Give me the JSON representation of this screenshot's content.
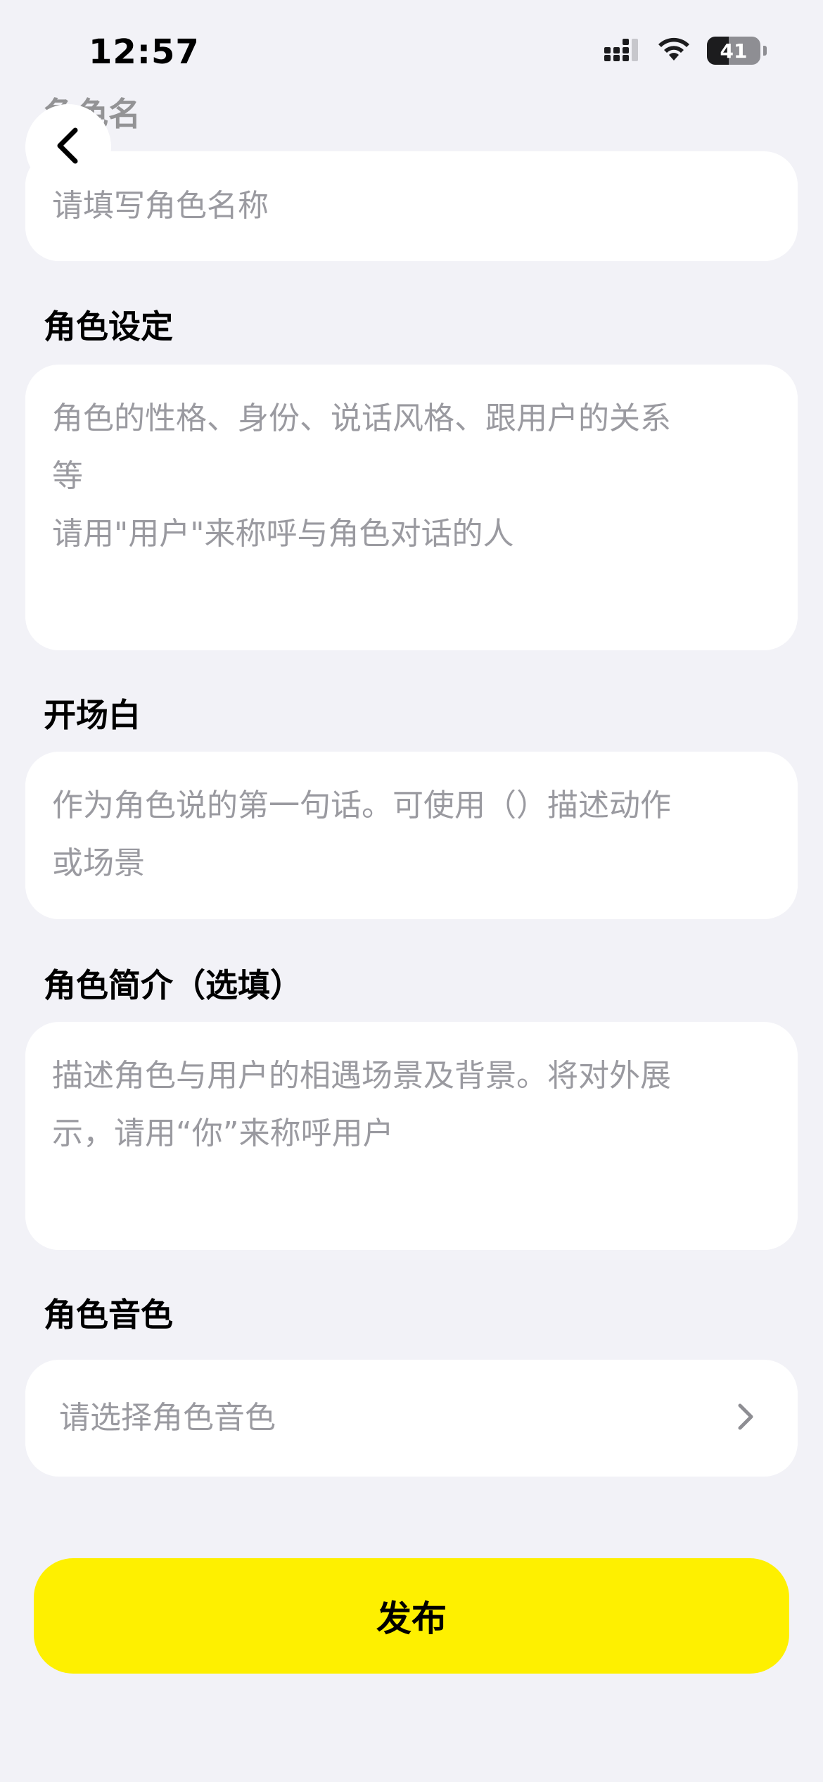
{
  "status_bar": {
    "time": "12:57",
    "battery_level": "41",
    "battery_fraction": 0.41,
    "icons": [
      "cellular-signal-icon",
      "wifi-icon",
      "battery-icon"
    ]
  },
  "nav": {
    "back_icon": "chevron-left-icon"
  },
  "form": {
    "name": {
      "label": "角色名",
      "placeholder": "请填写角色名称"
    },
    "setting": {
      "label": "角色设定",
      "placeholder_lines": [
        "角色的性格、身份、说话风格、跟用户的关系",
        "等",
        "请用\"用户\"来称呼与角色对话的人"
      ]
    },
    "opening": {
      "label": "开场白",
      "placeholder_lines": [
        "作为角色说的第一句话。可使用（）描述动作",
        "或场景"
      ]
    },
    "intro": {
      "label": "角色简介（选填）",
      "placeholder_lines": [
        "描述角色与用户的相遇场景及背景。将对外展",
        "示，请用“你”来称呼用户"
      ]
    },
    "voice": {
      "label": "角色音色",
      "placeholder": "请选择角色音色",
      "icon": "chevron-right-icon"
    }
  },
  "publish": {
    "label": "发布"
  },
  "colors": {
    "background": "#f2f2f7",
    "card": "#ffffff",
    "placeholder": "#9a9aa0",
    "accent": "#fef000"
  }
}
